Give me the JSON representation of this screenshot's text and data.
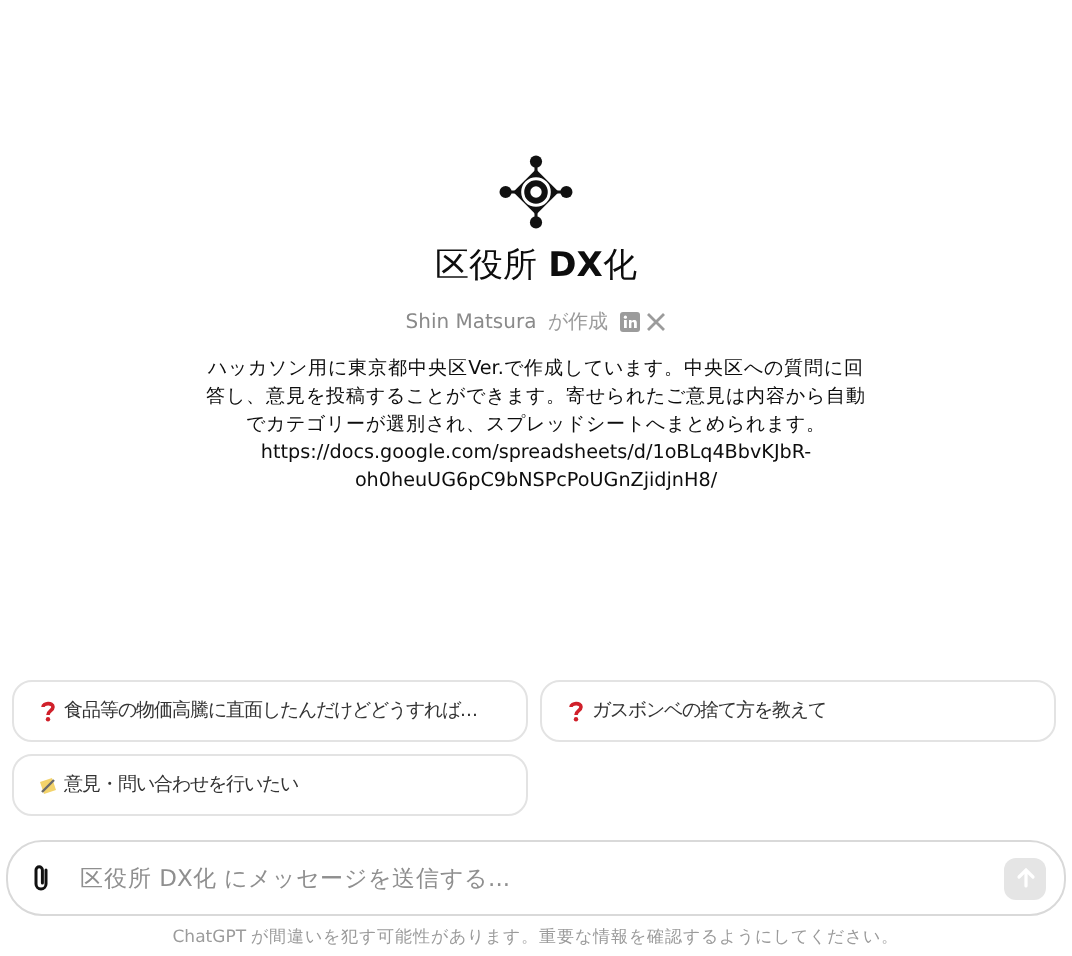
{
  "gpt": {
    "title": "区役所 **DX**化",
    "author": "Shin Matsura",
    "author_suffix": "が作成",
    "socials": [
      {
        "kind": "linkedin"
      },
      {
        "kind": "x"
      }
    ],
    "description": "ハッカソン用に東京都中央区Ver.で作成しています。中央区への質問に回答し、意見を投稿することができます。寄せられたご意見は内容から自動でカテゴリーが選別され、スプレッドシートへまとめられます。",
    "url": "https://docs.google.com/spreadsheets/d/1oBLq4BbvKJbR-oh0heuUG6pC9bNSPcPoUGnZjidjnH8/"
  },
  "suggestions": [
    {
      "kind": "question",
      "text": "食品等の物価高騰に直面したんだけどどうすれば..."
    },
    {
      "kind": "question",
      "text": "ガスボンベの捨て方を教えて"
    },
    {
      "kind": "memo",
      "text": "意見・問い合わせを行いたい"
    }
  ],
  "composer": {
    "placeholder": "区役所 DX化 にメッセージを送信する..."
  },
  "footer": "ChatGPT が間違いを犯す可能性があります。重要な情報を確認するようにしてください。"
}
